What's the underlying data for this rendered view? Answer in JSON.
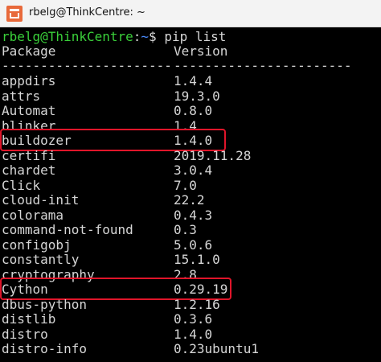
{
  "window": {
    "title": "rbelg@ThinkCentre: ~",
    "icon": "terminal-app-icon"
  },
  "terminal": {
    "prompt_user": "rbelg@ThinkCentre",
    "prompt_sep": ":",
    "prompt_path": "~",
    "prompt_symbol": "$",
    "command": " pip list",
    "header_package": "Package",
    "header_version": "Version",
    "dash_package": "----------------------",
    "dash_version": "-----------------------",
    "packages": [
      {
        "name": "appdirs",
        "version": "1.4.4"
      },
      {
        "name": "attrs",
        "version": "19.3.0"
      },
      {
        "name": "Automat",
        "version": "0.8.0"
      },
      {
        "name": "blinker",
        "version": "1.4"
      },
      {
        "name": "buildozer",
        "version": "1.4.0"
      },
      {
        "name": "certifi",
        "version": "2019.11.28"
      },
      {
        "name": "chardet",
        "version": "3.0.4"
      },
      {
        "name": "Click",
        "version": "7.0"
      },
      {
        "name": "cloud-init",
        "version": "22.2"
      },
      {
        "name": "colorama",
        "version": "0.4.3"
      },
      {
        "name": "command-not-found",
        "version": "0.3"
      },
      {
        "name": "configobj",
        "version": "5.0.6"
      },
      {
        "name": "constantly",
        "version": "15.1.0"
      },
      {
        "name": "cryptography",
        "version": "2.8"
      },
      {
        "name": "Cython",
        "version": "0.29.19"
      },
      {
        "name": "dbus-python",
        "version": "1.2.16"
      },
      {
        "name": "distlib",
        "version": "0.3.6"
      },
      {
        "name": "distro",
        "version": "1.4.0"
      },
      {
        "name": "distro-info",
        "version": "0.23ubuntu1"
      }
    ],
    "highlighted": [
      "buildozer",
      "Cython"
    ],
    "colors": {
      "background": "#000000",
      "text": "#d6d6d6",
      "prompt_user": "#3ad03a",
      "prompt_path": "#4a8cff",
      "highlight_box": "#e0152a"
    }
  }
}
